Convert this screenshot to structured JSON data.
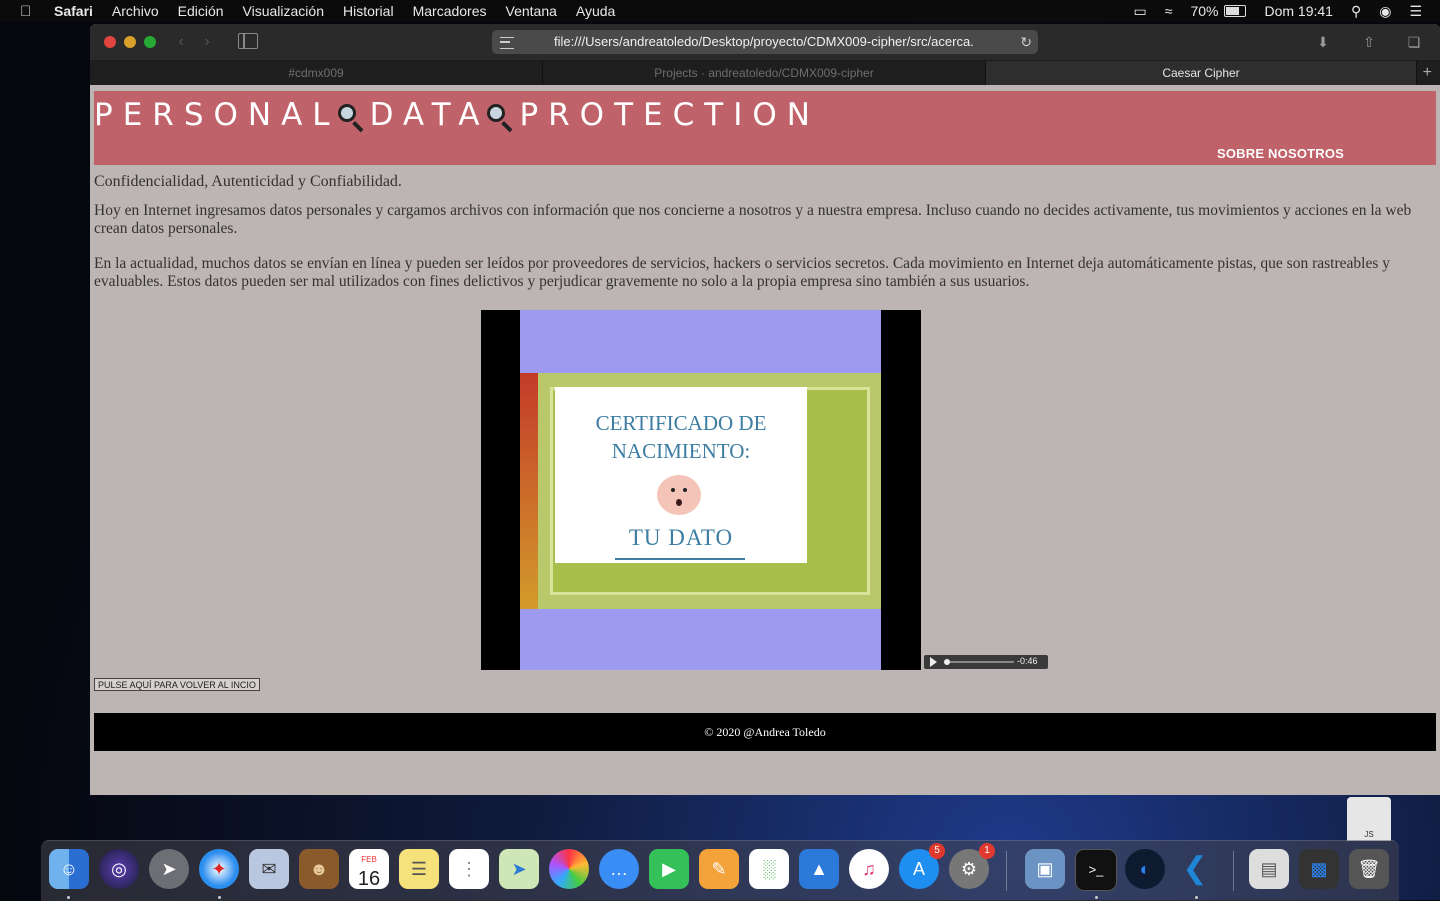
{
  "menubar": {
    "app_name": "Safari",
    "items": [
      "Archivo",
      "Edición",
      "Visualización",
      "Historial",
      "Marcadores",
      "Ventana",
      "Ayuda"
    ],
    "battery": "70%",
    "datetime": "Dom 19:41"
  },
  "browser": {
    "url": "file:///Users/andreatoledo/Desktop/proyecto/CDMX009-cipher/src/acerca.h",
    "tabs": [
      {
        "label": "#cdmx009",
        "active": false
      },
      {
        "label": "Projects · andreatoledo/CDMX009-cipher",
        "active": false
      },
      {
        "label": "Caesar Cipher",
        "active": true
      }
    ]
  },
  "page": {
    "title_words": [
      "PERSONAL",
      "DATA",
      "PROTECTION"
    ],
    "about_link": "SOBRE NOSOTROS",
    "subtitle": "Confidencialidad, Autenticidad y Confiabilidad.",
    "paragraphs": [
      "Hoy en Internet ingresamos datos personales y cargamos archivos con información que nos concierne a nosotros y a nuestra empresa. Incluso cuando no decides activamente, tus movimientos y acciones en la web crean datos personales.",
      "En la actualidad, muchos datos se envían en línea y pueden ser leídos por proveedores de servicios, hackers o servicios secretos. Cada movimiento en Internet deja automáticamente pistas, que son rastreables y evaluables. Estos datos pueden ser mal utilizados con fines delictivos y perjudicar gravemente no solo a la propia empresa sino también a sus usuarios."
    ],
    "video": {
      "cert_title": "CERTIFICADO DE NACIMIENTO:",
      "cert_name": "TU DATO"
    },
    "audio_time": "-0:46",
    "back_button": "PULSE AQUÍ PARA VOLVER AL INCIO",
    "footer": "© 2020 @Andrea Toledo"
  },
  "dock": {
    "icons": [
      "finder-icon",
      "siri-icon",
      "launchpad-icon",
      "safari-icon",
      "mail-icon",
      "contacts-icon",
      "calendar-icon",
      "notes-icon",
      "reminders-icon",
      "maps-icon",
      "photos-icon",
      "messages-icon",
      "facetime-icon",
      "pages-icon",
      "numbers-icon",
      "keynote-icon",
      "music-icon",
      "app-store-icon",
      "system-preferences-icon",
      "preview-icon",
      "terminal-icon",
      "browser-icon",
      "vscode-icon",
      "documents-icon",
      "screen-icon",
      "trash-icon"
    ],
    "calendar_month": "FEB",
    "calendar_day": "16",
    "app_store_badge": "5",
    "system_prefs_badge": "1",
    "desk_doc_label": "JS"
  }
}
